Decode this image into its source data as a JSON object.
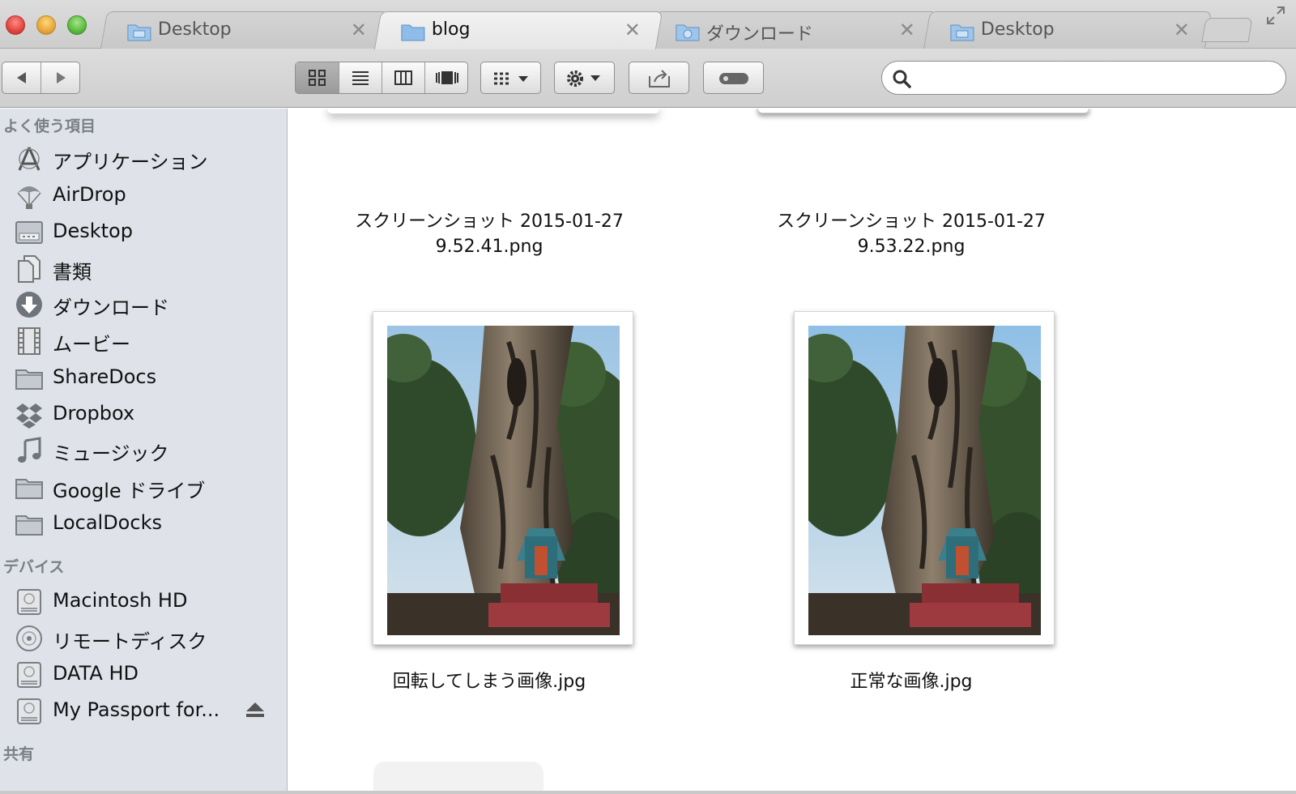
{
  "window": {
    "tabs": [
      {
        "label": "Desktop",
        "icon": "desktop-folder-icon",
        "active": false
      },
      {
        "label": "blog",
        "icon": "folder-icon",
        "active": true
      },
      {
        "label": "ダウンロード",
        "icon": "downloads-folder-icon",
        "active": false
      },
      {
        "label": "Desktop",
        "icon": "desktop-folder-icon",
        "active": false
      }
    ],
    "tab_close_symbol": "✕"
  },
  "toolbar": {
    "view_modes": [
      "icon-view",
      "list-view",
      "column-view",
      "cover-flow-view"
    ],
    "active_view": "icon-view",
    "search": {
      "value": "",
      "placeholder": ""
    }
  },
  "sidebar": {
    "favorites_header": "よく使う項目",
    "favorites": [
      {
        "label": "アプリケーション",
        "icon": "applications-icon"
      },
      {
        "label": "AirDrop",
        "icon": "airdrop-icon"
      },
      {
        "label": "Desktop",
        "icon": "desktop-folder-icon"
      },
      {
        "label": "書類",
        "icon": "documents-icon"
      },
      {
        "label": "ダウンロード",
        "icon": "downloads-icon"
      },
      {
        "label": "ムービー",
        "icon": "movies-icon"
      },
      {
        "label": "ShareDocs",
        "icon": "folder-icon"
      },
      {
        "label": "Dropbox",
        "icon": "dropbox-icon"
      },
      {
        "label": "ミュージック",
        "icon": "music-icon"
      },
      {
        "label": "Google ドライブ",
        "icon": "folder-icon"
      },
      {
        "label": "LocalDocks",
        "icon": "folder-icon"
      }
    ],
    "devices_header": "デバイス",
    "devices": [
      {
        "label": "Macintosh HD",
        "icon": "hard-drive-icon"
      },
      {
        "label": "リモートディスク",
        "icon": "remote-disc-icon"
      },
      {
        "label": "DATA HD",
        "icon": "hard-drive-icon"
      },
      {
        "label": "My Passport for...",
        "icon": "hard-drive-icon",
        "ejectable": true
      }
    ],
    "shared_header": "共有"
  },
  "content": {
    "files": [
      {
        "name_line1": "スクリーンショット 2015-01-27",
        "name_line2": "9.52.41.png"
      },
      {
        "name_line1": "スクリーンショット 2015-01-27",
        "name_line2": "9.53.22.png"
      },
      {
        "name_line1": "回転してしまう画像.jpg",
        "thumbnail": "tree-photo"
      },
      {
        "name_line1": "正常な画像.jpg",
        "thumbnail": "tree-photo"
      }
    ]
  }
}
